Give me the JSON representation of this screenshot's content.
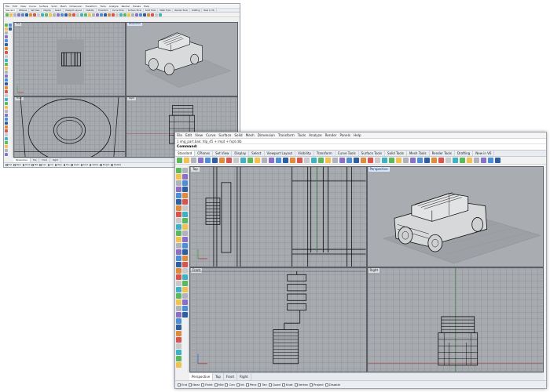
{
  "screenshot_small": {
    "menu": [
      "File",
      "Edit",
      "View",
      "Curve",
      "Surface",
      "Solid",
      "Mesh",
      "Dimension",
      "Transform",
      "Tools",
      "Analyze",
      "Render",
      "Panels",
      "Help"
    ],
    "tabs": [
      "Standard",
      "CPlanes",
      "Set View",
      "Display",
      "Select",
      "Viewport Layout",
      "Visibility",
      "Transform",
      "Curve Tools",
      "Surface Tools",
      "Solid Tools",
      "Mesh Tools",
      "Render Tools",
      "Drafting",
      "New in V6"
    ],
    "viewports": [
      {
        "title": "Top"
      },
      {
        "title": "Perspective"
      },
      {
        "title": "Front"
      },
      {
        "title": "Right"
      }
    ],
    "bottom_tabs": [
      "Perspective",
      "Top",
      "Front",
      "Right"
    ],
    "osnaps": [
      "End",
      "Near",
      "Point",
      "Mid",
      "Cen",
      "Int",
      "Perp",
      "Tan",
      "Quad",
      "Knot",
      "Vertex",
      "Project",
      "Disable"
    ]
  },
  "screenshot_large": {
    "menu": [
      "File",
      "Edit",
      "View",
      "Curve",
      "Surface",
      "Solid",
      "Mesh",
      "Dimension",
      "Transform",
      "Tools",
      "Analyze",
      "Render",
      "Panels",
      "Help"
    ],
    "status_line": "1 img_part.bak: fdp_45 + lmpt + fxpt.dlb",
    "command_prompt": "Command:",
    "tabs": [
      "Standard",
      "CPlanes",
      "Set View",
      "Display",
      "Select",
      "Viewport Layout",
      "Visibility",
      "Transform",
      "Curve Tools",
      "Surface Tools",
      "Solid Tools",
      "Mesh Tools",
      "Render Tools",
      "Drafting",
      "New in V6"
    ],
    "viewports": [
      {
        "title": "Top"
      },
      {
        "title": "Perspective"
      },
      {
        "title": "Front"
      },
      {
        "title": "Right"
      }
    ],
    "bottom_tabs": [
      "Perspective",
      "Top",
      "Front",
      "Right"
    ],
    "osnaps": [
      "End",
      "Near",
      "Point",
      "Mid",
      "Cen",
      "Int",
      "Perp",
      "Tan",
      "Quad",
      "Knot",
      "Vertex",
      "Project",
      "Disable"
    ]
  },
  "colors": {
    "viewport_bg": "#a7aaaf",
    "viewport_border": "#5b5f66",
    "active_title": "#d6e4f5",
    "geometry": "#111111"
  }
}
